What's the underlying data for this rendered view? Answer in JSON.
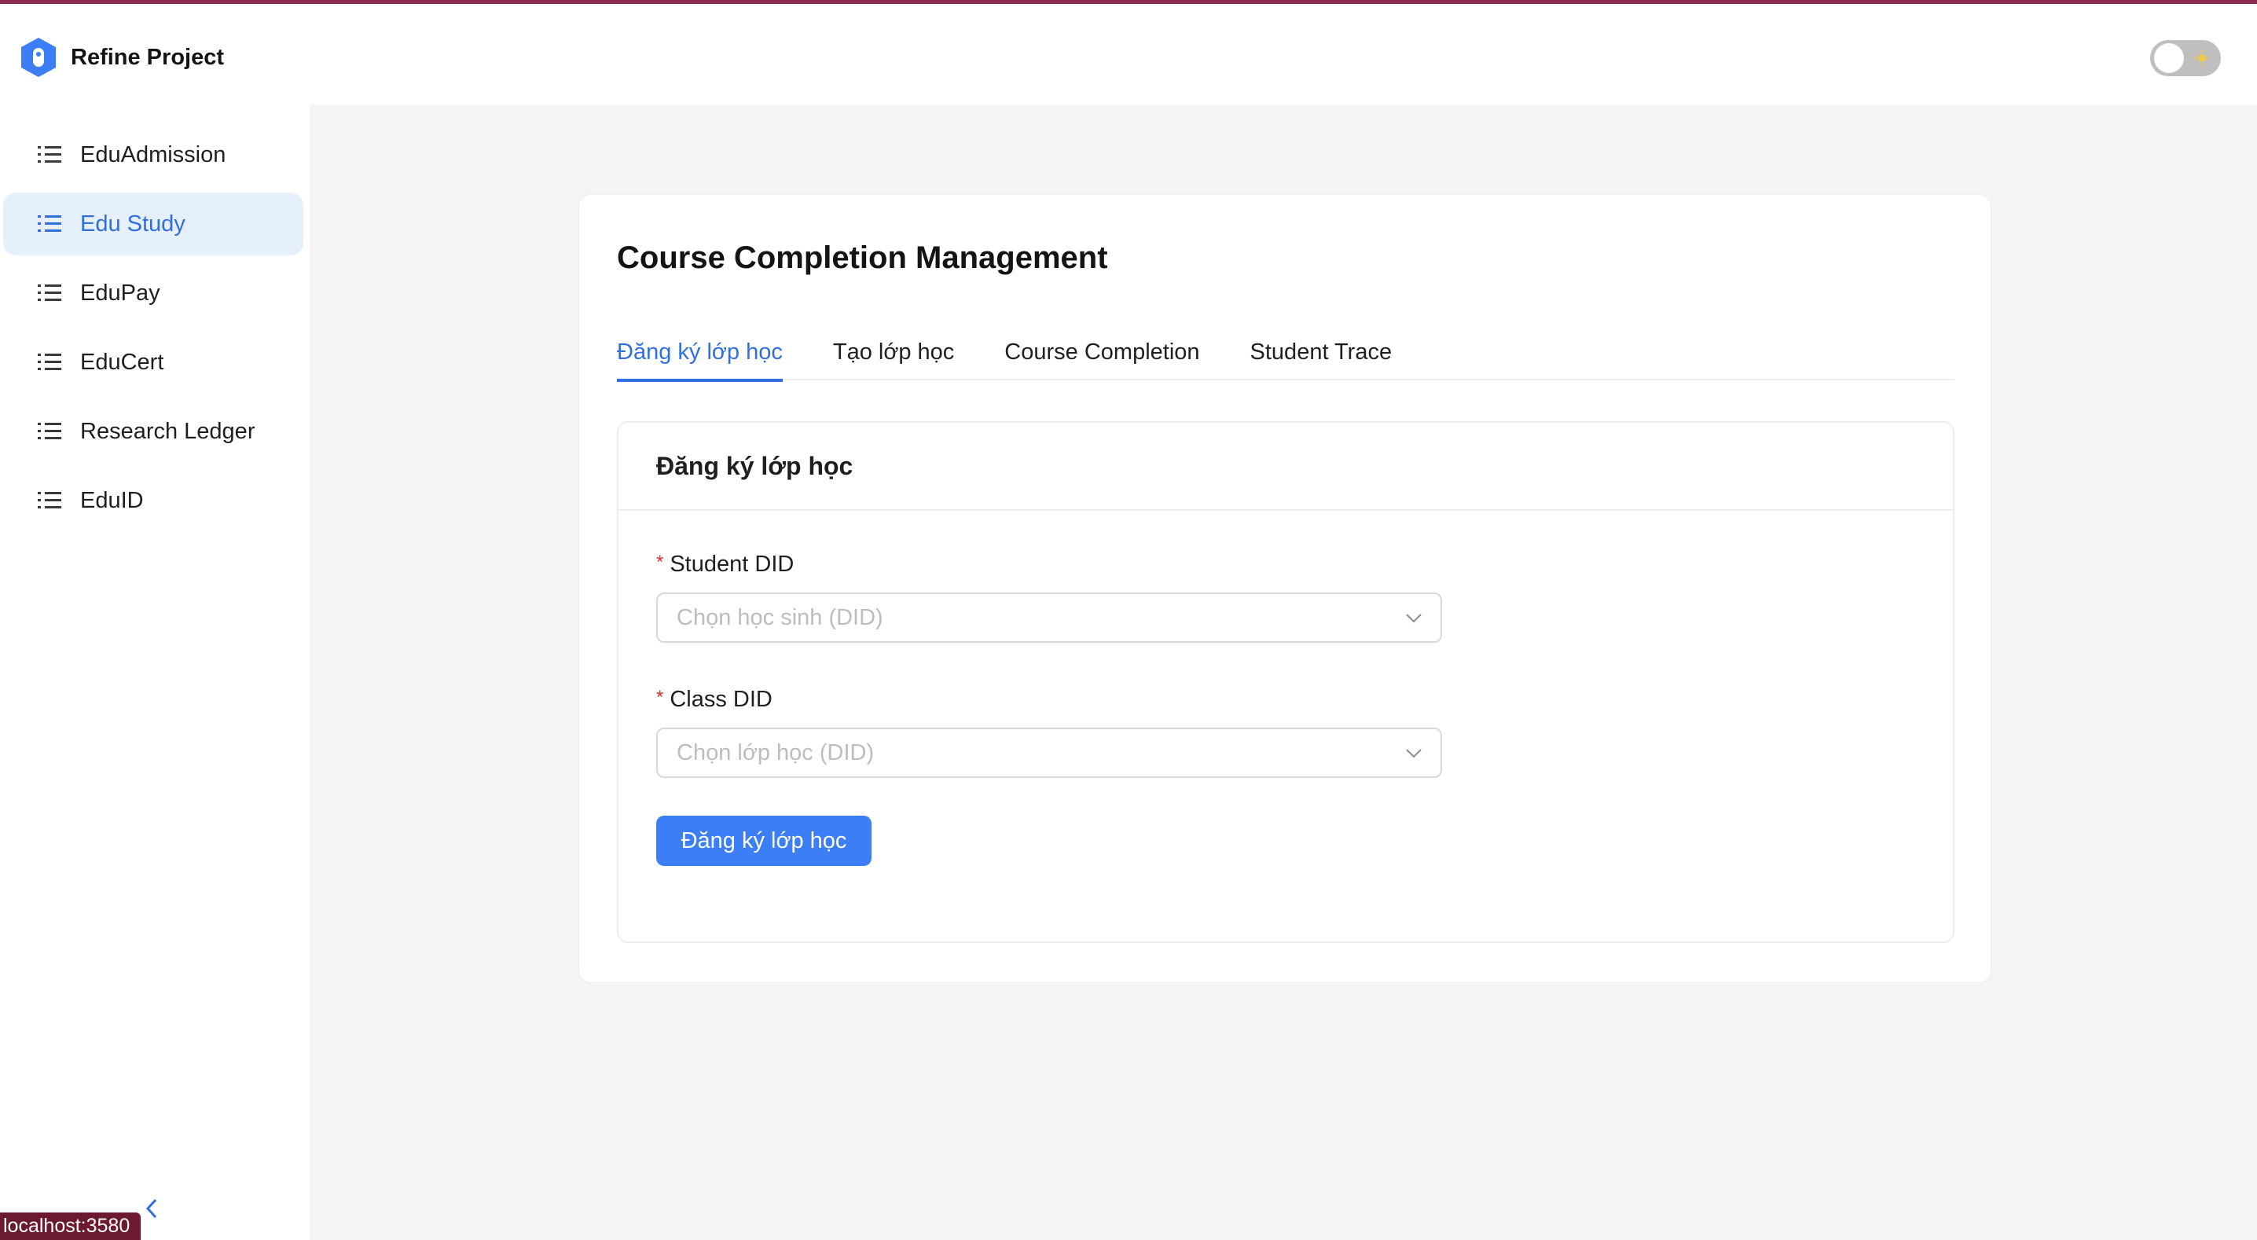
{
  "brand": {
    "title": "Refine Project"
  },
  "sidebar": {
    "items": [
      {
        "label": "EduAdmission",
        "active": false
      },
      {
        "label": "Edu Study",
        "active": true
      },
      {
        "label": "EduPay",
        "active": false
      },
      {
        "label": "EduCert",
        "active": false
      },
      {
        "label": "Research Ledger",
        "active": false
      },
      {
        "label": "EduID",
        "active": false
      }
    ]
  },
  "status_bar": {
    "url": "localhost:3580"
  },
  "header": {
    "theme_toggle": "light"
  },
  "colors": {
    "accent": "#2f6fe0",
    "button": "#3b7ef5",
    "required": "#e0312b",
    "top_line": "#8b2a4f"
  },
  "main": {
    "title": "Course Completion Management",
    "tabs": [
      {
        "label": "Đăng ký lớp học",
        "active": true
      },
      {
        "label": "Tạo lớp học",
        "active": false
      },
      {
        "label": "Course Completion",
        "active": false
      },
      {
        "label": "Student Trace",
        "active": false
      }
    ],
    "form": {
      "title": "Đăng ký lớp học",
      "student_label": "Student DID",
      "student_placeholder": "Chọn học sinh (DID)",
      "class_label": "Class DID",
      "class_placeholder": "Chọn lớp học (DID)",
      "required_mark": "*",
      "submit_label": "Đăng ký lớp học"
    }
  }
}
